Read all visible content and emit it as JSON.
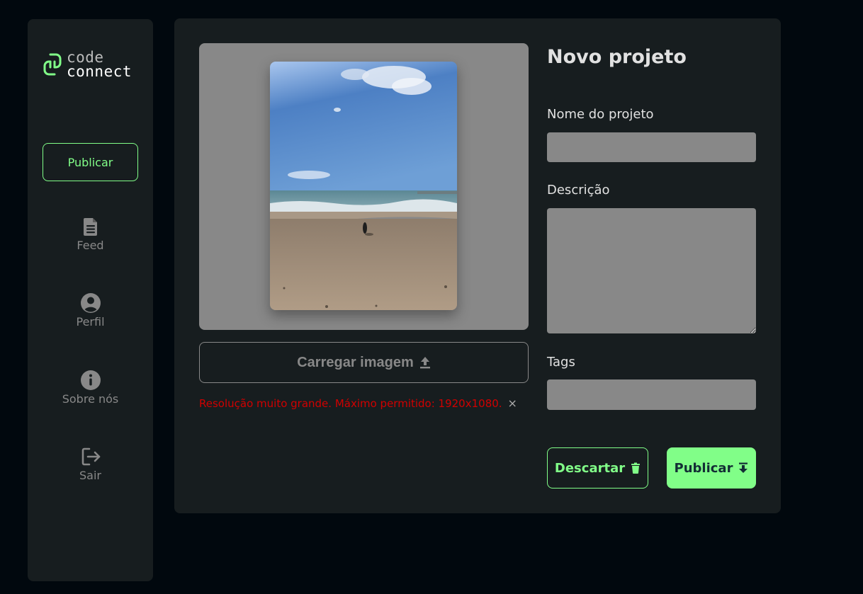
{
  "sidebar": {
    "logo": {
      "line1": "code",
      "line2": "connect",
      "icon": "code-connect-logo-icon"
    },
    "publish_label": "Publicar",
    "items": [
      {
        "label": "Feed",
        "icon": "document-icon"
      },
      {
        "label": "Perfil",
        "icon": "user-circle-icon"
      },
      {
        "label": "Sobre nós",
        "icon": "info-icon"
      },
      {
        "label": "Sair",
        "icon": "logout-icon"
      }
    ]
  },
  "preview": {
    "upload_label": "Carregar imagem",
    "upload_icon": "upload-icon",
    "error_message": "Resolução muito grande. Máximo permitido: 1920x1080.",
    "error_close": "×"
  },
  "form": {
    "title": "Novo projeto",
    "name_label": "Nome do projeto",
    "name_value": "",
    "description_label": "Descrição",
    "description_value": "",
    "tags_label": "Tags",
    "tags_value": "",
    "discard_label": "Descartar",
    "discard_icon": "trash-icon",
    "publish_label": "Publicar",
    "publish_icon": "download-icon"
  },
  "colors": {
    "background": "#01080e",
    "surface": "#171d1f",
    "accent": "#81fe88",
    "muted": "#888888",
    "error": "#d10000"
  }
}
